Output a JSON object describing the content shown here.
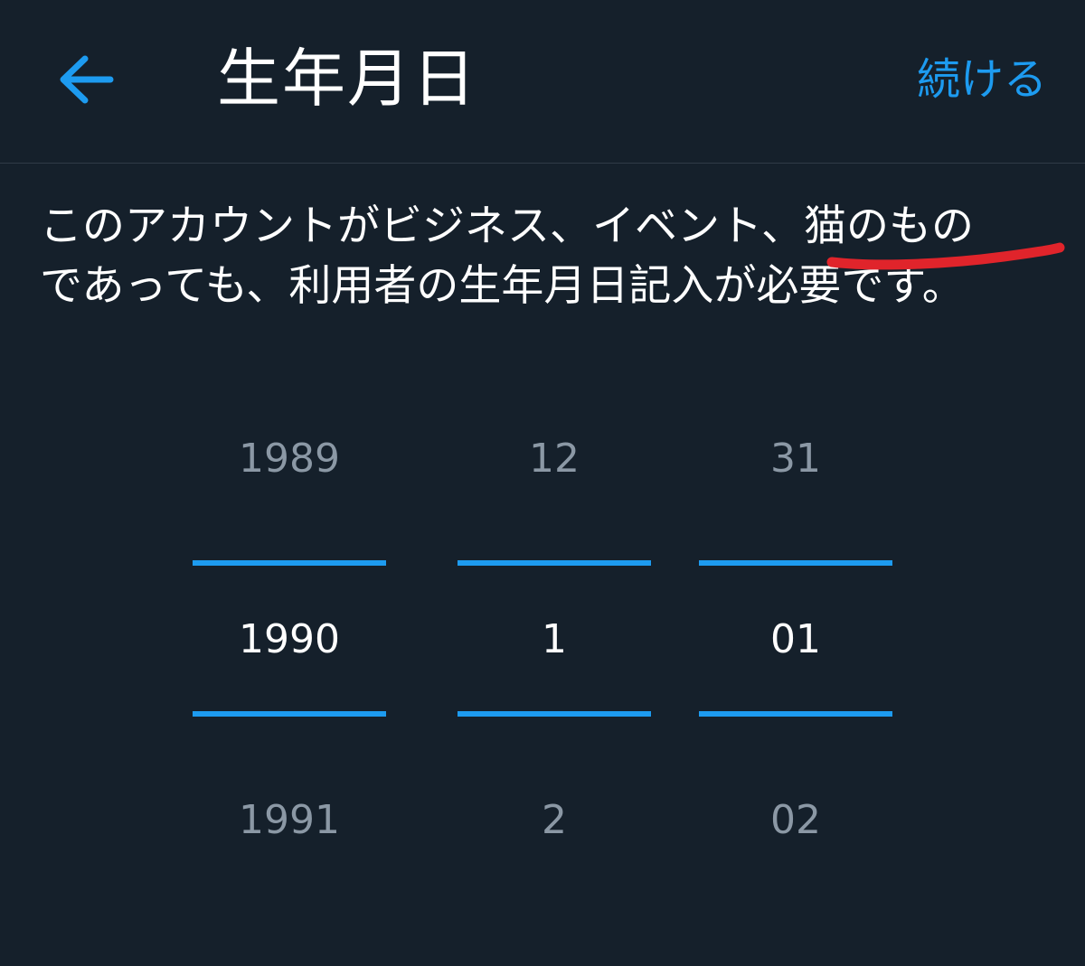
{
  "header": {
    "title": "生年月日",
    "continue_label": "続ける",
    "back_icon": "arrow-left-icon"
  },
  "description": {
    "line1": "このアカウントがビジネス、イベント、猫のもの",
    "line2": "であっても、利用者の生年月日記入が必要です。"
  },
  "picker": {
    "year": {
      "prev": "1989",
      "current": "1990",
      "next": "1991"
    },
    "month": {
      "prev": "12",
      "current": "1",
      "next": "2"
    },
    "day": {
      "prev": "31",
      "current": "01",
      "next": "02"
    }
  },
  "colors": {
    "background": "#15202b",
    "accent": "#1d9bf0",
    "muted_text": "#8b98a5",
    "annotation": "#e0242b"
  }
}
